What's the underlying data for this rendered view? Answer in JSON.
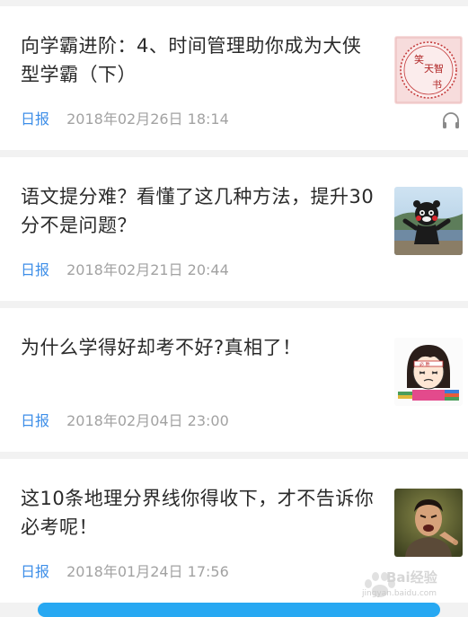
{
  "articles": [
    {
      "title": "向学霸进阶：4、时间管理助你成为大侠型学霸（下）",
      "tag": "日报",
      "date": "2018年02月26日 18:14",
      "thumbnail": "seal-icon",
      "thumbnail_text": "笑天智书",
      "has_audio": true
    },
    {
      "title": "语文提分难？看懂了这几种方法，提升30分不是问题？",
      "tag": "日报",
      "date": "2018年02月21日 20:44",
      "thumbnail": "kumamon-photo",
      "has_audio": false
    },
    {
      "title": "为什么学得好却考不好?真相了！",
      "tag": "日报",
      "date": "2018年02月04日 23:00",
      "thumbnail": "cartoon-student-icon",
      "has_audio": false
    },
    {
      "title": "这10条地理分界线你得收下，才不告诉你必考呢！",
      "tag": "日报",
      "date": "2018年01月24日 17:56",
      "thumbnail": "pointing-man-photo",
      "has_audio": false
    }
  ],
  "watermark": {
    "text": "Bai经验",
    "sub": "jingyan.baidu.com"
  },
  "colors": {
    "tag": "#3d8ee8",
    "date": "#a2a2a2",
    "title": "#2a2a2a",
    "background": "#f2f2f2",
    "bottom_bar": "#27a8f2"
  }
}
